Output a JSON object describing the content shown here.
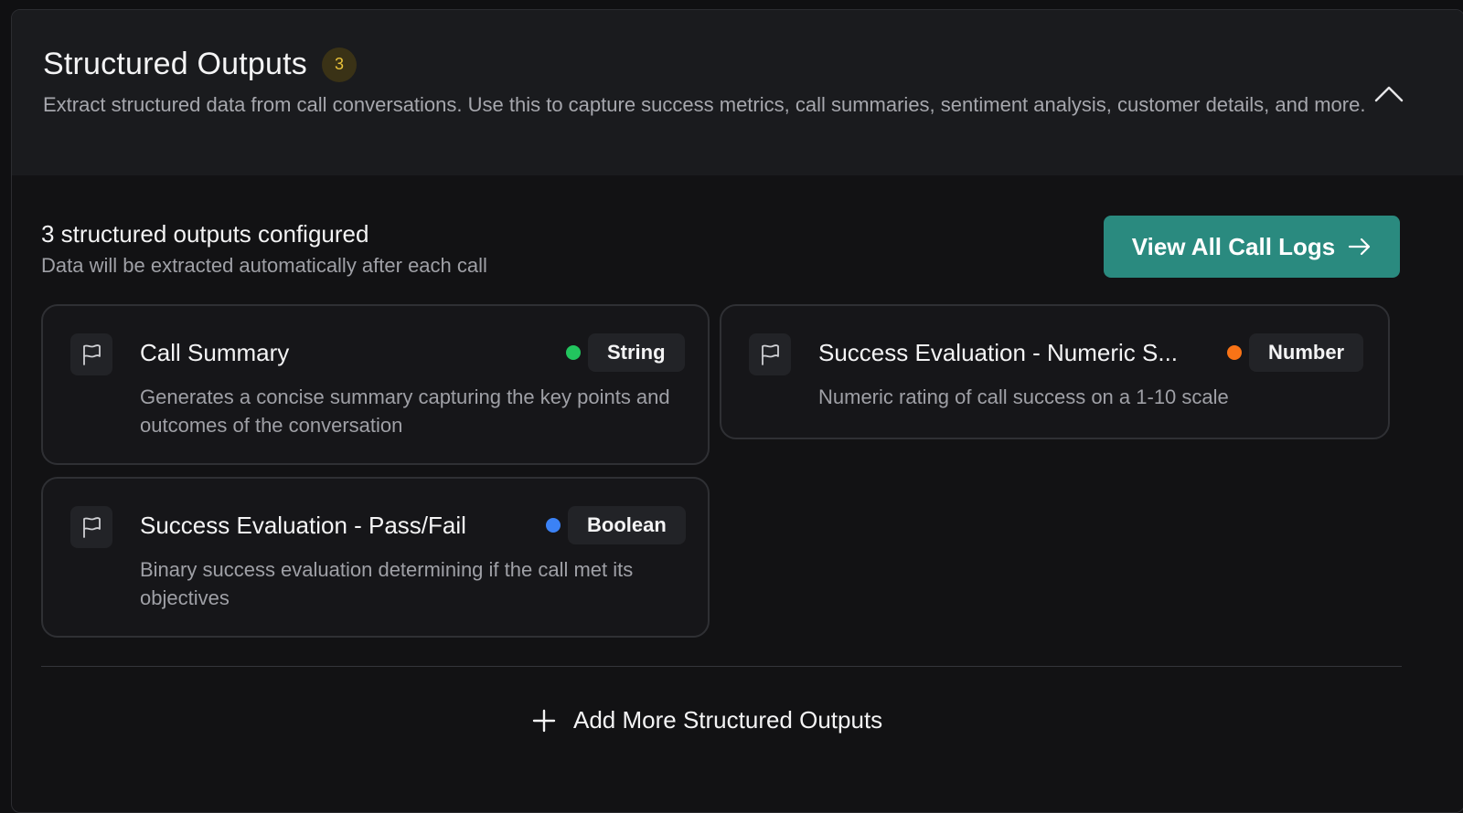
{
  "header": {
    "title": "Structured Outputs",
    "count": "3",
    "description": "Extract structured data from call conversations. Use this to capture success metrics, call summaries, sentiment analysis, customer details, and more."
  },
  "summary": {
    "title": "3 structured outputs configured",
    "subtitle": "Data will be extracted automatically after each call"
  },
  "view_logs_button": {
    "label": "View All Call Logs"
  },
  "outputs": [
    {
      "title": "Call Summary",
      "type": "String",
      "type_color": "#22c55e",
      "description": "Generates a concise summary capturing the key points and outcomes of the conversation",
      "icon": "flag-icon"
    },
    {
      "title": "Success Evaluation - Numeric S...",
      "type": "Number",
      "type_color": "#f97316",
      "description": "Numeric rating of call success on a 1-10 scale",
      "icon": "flag-icon"
    },
    {
      "title": "Success Evaluation - Pass/Fail",
      "type": "Boolean",
      "type_color": "#3b82f6",
      "description": "Binary success evaluation determining if the call met its objectives",
      "icon": "flag-icon"
    }
  ],
  "add_more_button": {
    "label": "Add More Structured Outputs",
    "icon": "plus-icon"
  },
  "colors": {
    "accent": "#2a8a7f",
    "badge_text": "#e9c23a",
    "badge_bg": "#3a3216",
    "background": "#121214"
  }
}
